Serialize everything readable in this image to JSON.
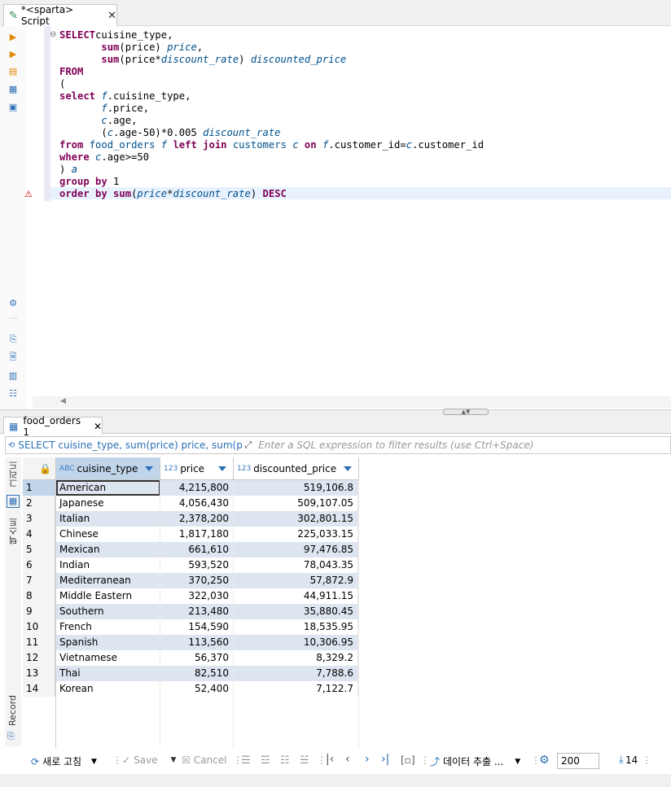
{
  "editor_tab": {
    "title": "*<sparta> Script",
    "close": "✕"
  },
  "sql_lines": [
    [
      [
        "kw",
        "SELECT"
      ],
      [
        "",
        "cuisine_type,"
      ]
    ],
    [
      [
        "",
        "       "
      ],
      [
        "fn",
        "sum"
      ],
      [
        "",
        "(price) "
      ],
      [
        "al",
        "price"
      ],
      [
        "",
        ","
      ]
    ],
    [
      [
        "",
        "       "
      ],
      [
        "fn",
        "sum"
      ],
      [
        "",
        "(price*"
      ],
      [
        "al",
        "discount_rate"
      ],
      [
        "",
        ") "
      ],
      [
        "al",
        "discounted_price"
      ]
    ],
    [
      [
        "kw",
        "FROM"
      ]
    ],
    [
      [
        "",
        "("
      ]
    ],
    [
      [
        "kw",
        "select"
      ],
      [
        "",
        " "
      ],
      [
        "al",
        "f"
      ],
      [
        "",
        ".cuisine_type,"
      ]
    ],
    [
      [
        "",
        "       "
      ],
      [
        "al",
        "f"
      ],
      [
        "",
        ".price,"
      ]
    ],
    [
      [
        "",
        "       "
      ],
      [
        "al",
        "c"
      ],
      [
        "",
        ".age,"
      ]
    ],
    [
      [
        "",
        "       ("
      ],
      [
        "al",
        "c"
      ],
      [
        "",
        ".age-50)*0.005 "
      ],
      [
        "al",
        "discount_rate"
      ]
    ],
    [
      [
        "kw",
        "from"
      ],
      [
        "",
        " "
      ],
      [
        "id",
        "food_orders"
      ],
      [
        "",
        " "
      ],
      [
        "al",
        "f"
      ],
      [
        "",
        " "
      ],
      [
        "kw",
        "left join"
      ],
      [
        "",
        " "
      ],
      [
        "id",
        "customers"
      ],
      [
        "",
        " "
      ],
      [
        "al",
        "c"
      ],
      [
        "",
        " "
      ],
      [
        "kw",
        "on"
      ],
      [
        "",
        " "
      ],
      [
        "al",
        "f"
      ],
      [
        "",
        ".customer_id="
      ],
      [
        "al",
        "c"
      ],
      [
        "",
        ".customer_id"
      ]
    ],
    [
      [
        "kw",
        "where"
      ],
      [
        "",
        " "
      ],
      [
        "al",
        "c"
      ],
      [
        "",
        ".age>=50"
      ]
    ],
    [
      [
        "",
        ") "
      ],
      [
        "al",
        "a"
      ]
    ],
    [
      [
        "kw",
        "group by"
      ],
      [
        "",
        " 1"
      ]
    ],
    [
      [
        "kw",
        "order by"
      ],
      [
        "",
        " "
      ],
      [
        "fn",
        "sum"
      ],
      [
        "",
        "("
      ],
      [
        "al",
        "price"
      ],
      [
        "",
        "*"
      ],
      [
        "al",
        "discount_rate"
      ],
      [
        "",
        ") "
      ],
      [
        "kw",
        "DESC"
      ]
    ]
  ],
  "results_tab": {
    "title": "food_orders 1",
    "close": "✕"
  },
  "filter": {
    "query": "SELECT cuisine_type, sum(price) price, sum(pric",
    "placeholder": "Enter a SQL expression to filter results (use Ctrl+Space)"
  },
  "side_tabs": {
    "grid": "그리드",
    "text": "텍스트",
    "record": "Record"
  },
  "columns": [
    {
      "type": "ABC",
      "name": "cuisine_type"
    },
    {
      "type": "123",
      "name": "price"
    },
    {
      "type": "123",
      "name": "discounted_price"
    }
  ],
  "rows": [
    {
      "n": "1",
      "cuisine": "American",
      "price": "4,215,800",
      "disc": "519,106.8"
    },
    {
      "n": "2",
      "cuisine": "Japanese",
      "price": "4,056,430",
      "disc": "509,107.05"
    },
    {
      "n": "3",
      "cuisine": "Italian",
      "price": "2,378,200",
      "disc": "302,801.15"
    },
    {
      "n": "4",
      "cuisine": "Chinese",
      "price": "1,817,180",
      "disc": "225,033.15"
    },
    {
      "n": "5",
      "cuisine": "Mexican",
      "price": "661,610",
      "disc": "97,476.85"
    },
    {
      "n": "6",
      "cuisine": "Indian",
      "price": "593,520",
      "disc": "78,043.35"
    },
    {
      "n": "7",
      "cuisine": "Mediterranean",
      "price": "370,250",
      "disc": "57,872.9"
    },
    {
      "n": "8",
      "cuisine": "Middle Eastern",
      "price": "322,030",
      "disc": "44,911.15"
    },
    {
      "n": "9",
      "cuisine": "Southern",
      "price": "213,480",
      "disc": "35,880.45"
    },
    {
      "n": "10",
      "cuisine": "French",
      "price": "154,590",
      "disc": "18,535.95"
    },
    {
      "n": "11",
      "cuisine": "Spanish",
      "price": "113,560",
      "disc": "10,306.95"
    },
    {
      "n": "12",
      "cuisine": "Vietnamese",
      "price": "56,370",
      "disc": "8,329.2"
    },
    {
      "n": "13",
      "cuisine": "Thai",
      "price": "82,510",
      "disc": "7,788.6"
    },
    {
      "n": "14",
      "cuisine": "Korean",
      "price": "52,400",
      "disc": "7,122.7"
    }
  ],
  "bottom": {
    "refresh": "새로 고침",
    "save": "Save",
    "cancel": "Cancel",
    "export": "데이터 추출 ...",
    "fetch_size": "200",
    "row_count": "14"
  },
  "colors": {
    "keyword": "#7f0055",
    "alias": "#00508c",
    "selected_row": "#c0d4ea",
    "alt_row": "#dde5f0"
  }
}
